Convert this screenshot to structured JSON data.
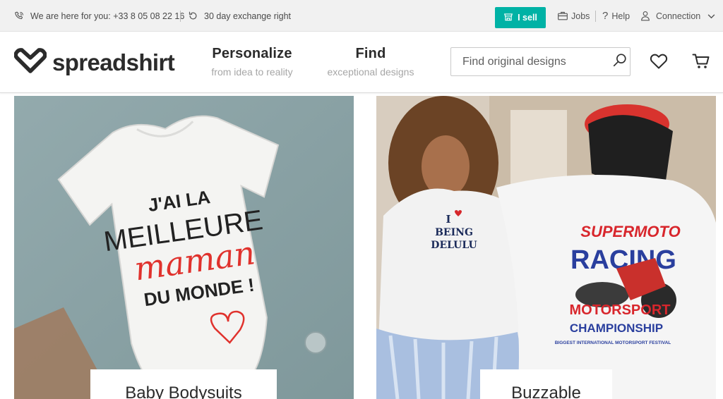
{
  "topbar": {
    "phone_text": "We are here for you: +33 8 05 08 22 16",
    "exchange_text": "30 day exchange right",
    "sell_label": "I sell",
    "jobs_label": "Jobs",
    "help_label": "Help",
    "connection_label": "Connection"
  },
  "header": {
    "logo_text": "spreadshirt",
    "nav": [
      {
        "title": "Personalize",
        "subtitle": "from idea to reality"
      },
      {
        "title": "Find",
        "subtitle": "exceptional designs"
      }
    ],
    "search_placeholder": "Find original designs"
  },
  "tiles": [
    {
      "label": "Baby Bodysuits",
      "print_lines": [
        "J'AI LA",
        "MEILLEURE",
        "maman",
        "DU MONDE !"
      ]
    },
    {
      "label": "Buzzable",
      "front_print": [
        "I",
        "BEING",
        "DELULU"
      ],
      "back_print": [
        "SUPERMOTO",
        "RACING",
        "MOTORSPORT",
        "CHAMPIONSHIP",
        "BIGGEST INTERNATIONAL MOTORSPORT FESTIVAL"
      ]
    }
  ],
  "colors": {
    "accent": "#00b2a5",
    "topbar_bg": "#f1f1f1",
    "text": "#2b2b2b",
    "muted": "#a6a6a6"
  },
  "icons": [
    "phone-icon",
    "return-icon",
    "shop-icon",
    "briefcase-icon",
    "question-icon",
    "user-icon",
    "chevron-down-icon",
    "search-icon",
    "heart-icon",
    "cart-icon"
  ]
}
